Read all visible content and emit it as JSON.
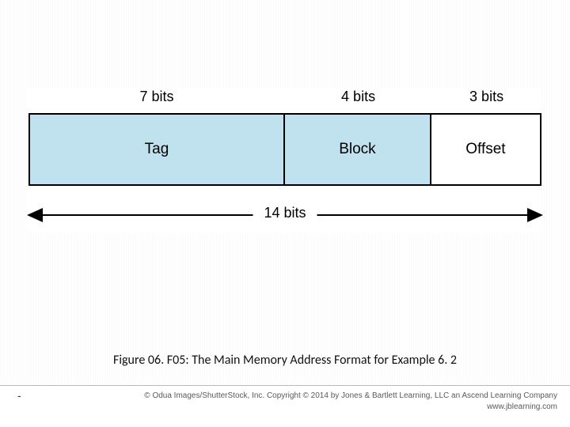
{
  "chart_data": {
    "type": "table",
    "title": "Main Memory Address Format",
    "fields": [
      {
        "name": "Tag",
        "bits": 7
      },
      {
        "name": "Block",
        "bits": 4
      },
      {
        "name": "Offset",
        "bits": 3
      }
    ],
    "total_bits": 14
  },
  "diagram": {
    "bits_labels": {
      "tag": "7 bits",
      "block": "4 bits",
      "offset": "3 bits"
    },
    "field_labels": {
      "tag": "Tag",
      "block": "Block",
      "offset": "Offset"
    },
    "total_label": "14 bits",
    "colors": {
      "shaded": "#c0e2ee",
      "border": "#000000"
    }
  },
  "caption": "Figure 06. F05: The Main Memory Address Format for Example 6. 2",
  "footer": {
    "dash": "-",
    "credit_line1": "© Odua Images/ShutterStock, Inc. Copyright © 2014 by Jones & Bartlett Learning, LLC an Ascend Learning Company",
    "credit_line2": "www.jblearning.com"
  }
}
